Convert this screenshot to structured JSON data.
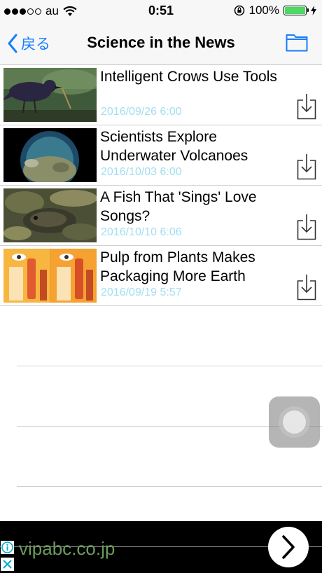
{
  "status_bar": {
    "carrier": "au",
    "time": "0:51",
    "battery_percent": "100%",
    "battery_level": 1.0,
    "signal_bars_filled": 3,
    "signal_bars_total": 5
  },
  "nav": {
    "back_label": "戻る",
    "title": "Science in the News",
    "folder_icon": "folder-icon",
    "accent_color": "#157efb"
  },
  "articles": [
    {
      "title": "Intelligent Crows Use Tools",
      "date": "2016/09/26 6:00",
      "thumbnail": "crow-photo"
    },
    {
      "title": "Scientists Explore Underwater Volcanoes",
      "date": "2016/10/03 6:00",
      "thumbnail": "underwater-volcano-photo"
    },
    {
      "title": "A Fish That 'Sings' Love Songs?",
      "date": "2016/10/10 6:06",
      "thumbnail": "fish-photo"
    },
    {
      "title": "Pulp from Plants Makes Packaging More Earth",
      "date": "2016/09/19 5:57",
      "thumbnail": "mascara-packaging-photo"
    }
  ],
  "ad": {
    "url_text": "vipabc.co.jp",
    "info_icon": "info-icon",
    "close_icon": "close-icon",
    "action_icon": "chevron-right-icon"
  },
  "colors": {
    "date_text": "#a2def0",
    "separator": "#d0d0d4",
    "battery_fill": "#4cd964"
  }
}
